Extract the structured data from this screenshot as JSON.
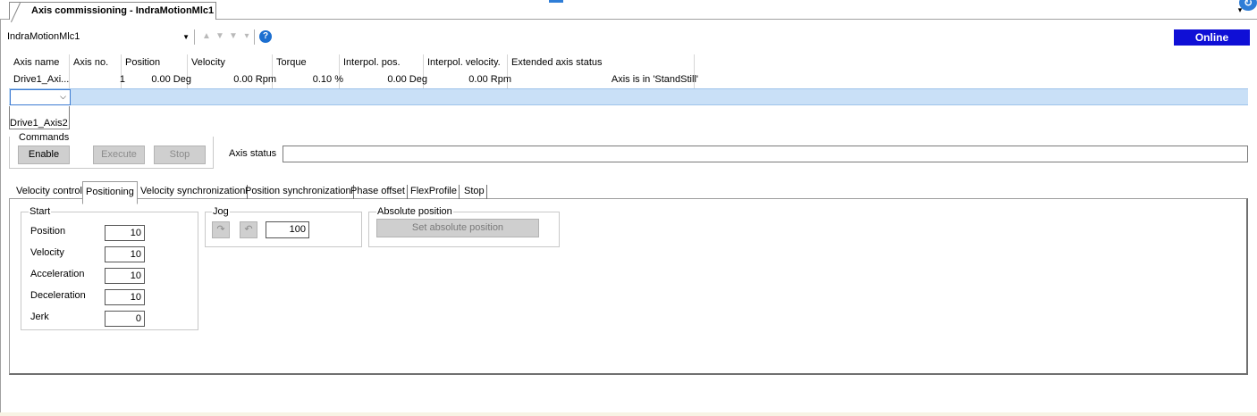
{
  "document_tab": {
    "title": "Axis commissioning - IndraMotionMlc1"
  },
  "toolbar": {
    "device": "IndraMotionMlc1",
    "nav_up": "▲",
    "nav_down": "▼",
    "nav_down2": "▼",
    "overflow": "▾",
    "help": "?",
    "online_label": "Online"
  },
  "grid": {
    "columns": [
      "Axis name",
      "Axis no.",
      "Position",
      "Velocity",
      "Torque",
      "Interpol. pos.",
      "Interpol. velocity.",
      "Extended axis status"
    ],
    "row": [
      "Drive1_Axi...",
      "1",
      "0.00 Deg",
      "0.00 Rpm",
      "0.10 %",
      "0.00 Deg",
      "0.00 Rpm",
      "Axis is in 'StandStill'"
    ],
    "combo_chevron": "⌵",
    "dropdown_option": "Drive1_Axis2"
  },
  "commands": {
    "title": "Commands",
    "enable": "Enable",
    "execute": "Execute",
    "stop": "Stop",
    "axis_status_label": "Axis status",
    "axis_status_value": ""
  },
  "tabs": [
    "Velocity control",
    "Positioning",
    "Velocity synchronization",
    "Position synchronization",
    "Phase offset",
    "FlexProfile",
    "Stop"
  ],
  "active_tab": "Positioning",
  "start": {
    "title": "Start",
    "fields": [
      {
        "label": "Position",
        "value": "10"
      },
      {
        "label": "Velocity",
        "value": "10"
      },
      {
        "label": "Acceleration",
        "value": "10"
      },
      {
        "label": "Deceleration",
        "value": "10"
      },
      {
        "label": "Jerk",
        "value": "0"
      }
    ]
  },
  "jog": {
    "title": "Jog",
    "forward_icon": "↷",
    "backward_icon": "↶",
    "value": "100"
  },
  "absolute": {
    "title": "Absolute position",
    "button": "Set absolute position"
  },
  "colors": {
    "online": "#0f0fd6",
    "selection": "#c9e0f7",
    "help": "#1c6fd0"
  }
}
